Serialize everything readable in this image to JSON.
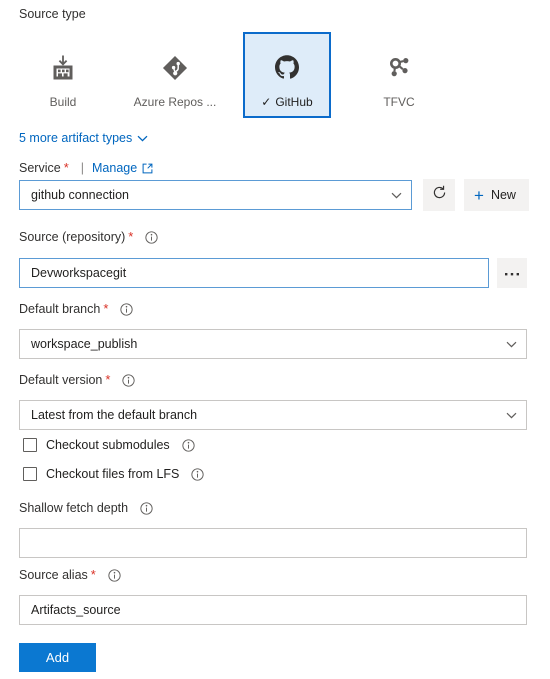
{
  "source_type": {
    "title": "Source type",
    "tiles": [
      {
        "label": "Build",
        "icon": "build-icon",
        "selected": false
      },
      {
        "label": "Azure Repos ...",
        "icon": "azure-repos-icon",
        "selected": false
      },
      {
        "label": "GitHub",
        "icon": "github-icon",
        "selected": true
      },
      {
        "label": "TFVC",
        "icon": "tfvc-icon",
        "selected": false
      }
    ],
    "more_link": "5 more artifact types"
  },
  "service": {
    "label": "Service",
    "required": "*",
    "separator": "|",
    "manage_label": "Manage",
    "value": "github connection",
    "refresh_tooltip": "Refresh",
    "new_label": "New"
  },
  "source_repository": {
    "label": "Source (repository)",
    "required": "*",
    "value": "Devworkspacegit",
    "browse_label": "..."
  },
  "default_branch": {
    "label": "Default branch",
    "required": "*",
    "value": "workspace_publish"
  },
  "default_version": {
    "label": "Default version",
    "required": "*",
    "value": "Latest from the default branch"
  },
  "checkout_submodules": {
    "label": "Checkout submodules",
    "checked": false
  },
  "checkout_lfs": {
    "label": "Checkout files from LFS",
    "checked": false
  },
  "shallow_fetch_depth": {
    "label": "Shallow fetch depth",
    "value": "",
    "placeholder": ""
  },
  "source_alias": {
    "label": "Source alias",
    "required": "*",
    "value": "Artifacts_source"
  },
  "actions": {
    "add_label": "Add"
  },
  "colors": {
    "accent": "#0078d4",
    "link": "#0066bf",
    "required": "#d93025",
    "selected_tile_bg": "#deecf9",
    "selected_tile_border": "#0b6bcb",
    "button_bg": "#f3f2f1",
    "field_border": "#c8c6c4",
    "focus_border": "#5b9bd5"
  }
}
